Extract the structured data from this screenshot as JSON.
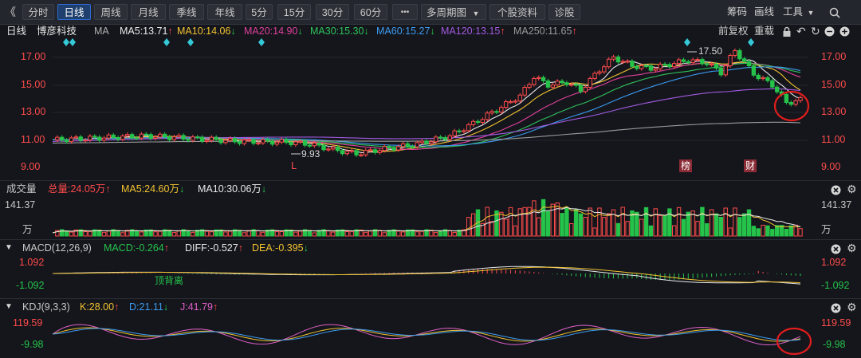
{
  "toolbar": {
    "collapse": "《",
    "periods": [
      "分时",
      "日线",
      "周线",
      "月线",
      "季线",
      "年线",
      "5分",
      "15分",
      "30分",
      "60分"
    ],
    "more": "•••",
    "multi_period": "多周期图",
    "profile": "个股资料",
    "diagnose": "诊股",
    "right": [
      "筹码",
      "画线",
      "工具"
    ],
    "search_icon": "search-icon"
  },
  "main": {
    "period": "日线",
    "name": "博彦科技",
    "ma_label": "MA",
    "ma": [
      {
        "label": "MA5:13.71",
        "arrow": "↑",
        "color": "#e8e8e8"
      },
      {
        "label": "MA10:14.06",
        "arrow": "↓",
        "color": "#f2c230"
      },
      {
        "label": "MA20:14.90",
        "arrow": "↓",
        "color": "#e0409a"
      },
      {
        "label": "MA30:15.30",
        "arrow": "↓",
        "color": "#2fc25b"
      },
      {
        "label": "MA60:15.27",
        "arrow": "↓",
        "color": "#3d9bf0"
      },
      {
        "label": "MA120:13.15",
        "arrow": "↑",
        "color": "#a25ae0"
      },
      {
        "label": "MA250:11.65",
        "arrow": "↑",
        "color": "#9a9a9a"
      }
    ],
    "restore": "前复权",
    "overlay": "重载",
    "y_ticks": [
      "17.00",
      "15.00",
      "13.00",
      "11.00",
      "9.00"
    ],
    "high_label": "17.50",
    "low_label": "9.93",
    "mark_L": "L",
    "tag_bang": "榜",
    "tag_cai": "财"
  },
  "volume": {
    "title": "成交量",
    "total": "总量:24.05万",
    "total_arrow": "↑",
    "ma5": "MA5:24.60万",
    "ma5_arrow": "↓",
    "ma10": "MA10:30.06万",
    "ma10_arrow": "↓",
    "y_top": "141.37",
    "unit": "万"
  },
  "macd": {
    "title": "MACD(12,26,9)",
    "macd": "MACD:-0.264",
    "macd_arrow": "↑",
    "diff": "DIFF:-0.527",
    "diff_arrow": "↑",
    "dea": "DEA:-0.395",
    "dea_arrow": "↓",
    "y_top": "1.092",
    "y_bottom": "-1.092",
    "annotation": "顶背离"
  },
  "kdj": {
    "title": "KDJ(9,3,3)",
    "k": "K:28.00",
    "k_arrow": "↑",
    "d": "D:21.11",
    "d_arrow": "↓",
    "j": "J:41.79",
    "j_arrow": "↑",
    "y_top": "119.59",
    "y_bottom": "-9.98"
  },
  "colors": {
    "up": "#ff4b4b",
    "down": "#26c34b",
    "bg": "#14161c",
    "accent": "#2e6ad1"
  }
}
